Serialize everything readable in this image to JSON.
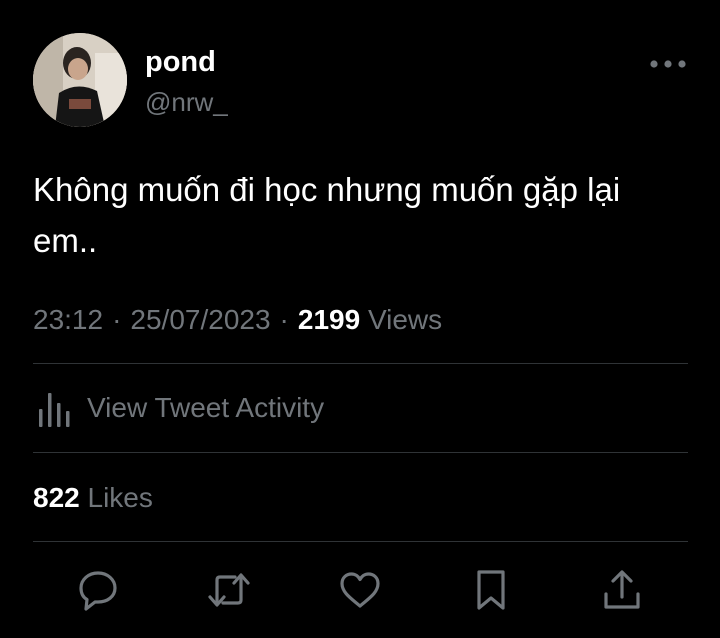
{
  "user": {
    "display_name": "pond",
    "handle": "@nrw_"
  },
  "tweet": {
    "text": "Không muốn đi học nhưng muốn gặp lại em..",
    "time": "23:12",
    "date": "25/07/2023",
    "views_count": "2199",
    "views_label": "Views",
    "separator": "·"
  },
  "activity": {
    "label": "View Tweet Activity",
    "icon": "bar-chart-icon"
  },
  "likes": {
    "count": "822",
    "label": "Likes"
  },
  "actions": [
    "reply-icon",
    "retweet-icon",
    "like-icon",
    "bookmark-icon",
    "share-icon"
  ],
  "colors": {
    "background": "#000000",
    "primary_text": "#ffffff",
    "secondary_text": "#71767b",
    "divider": "#2f3336"
  }
}
